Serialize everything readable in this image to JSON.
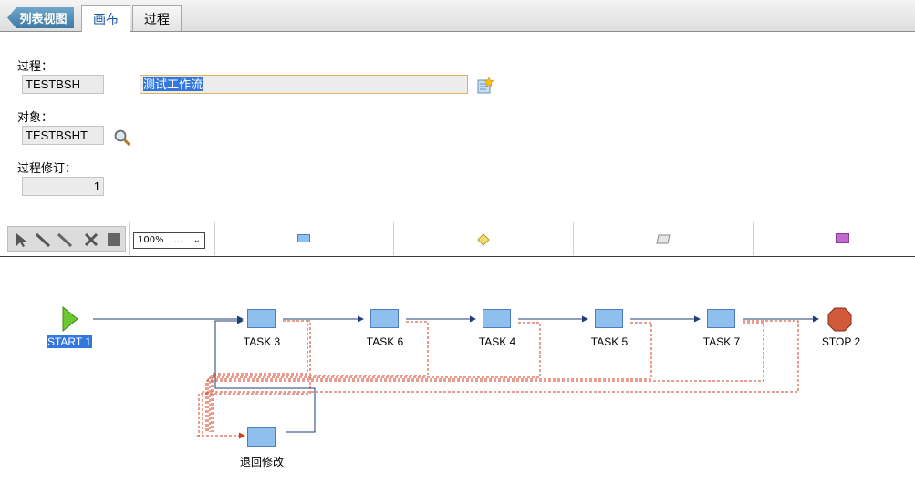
{
  "header": {
    "back_label": "列表视图",
    "tabs": [
      {
        "label": "画布",
        "active": true
      },
      {
        "label": "过程",
        "active": false
      }
    ]
  },
  "form": {
    "process_label": "过程：",
    "process_value": "TESTBSH",
    "process_desc": "测试工作流",
    "object_label": "对象：",
    "object_value": "TESTBSHT",
    "revision_label": "过程修订：",
    "revision_value": "1"
  },
  "toolbar": {
    "zoom": "100%",
    "zoom_suffix": "...",
    "palette_items": [
      "task-shape",
      "decision-shape",
      "input-shape",
      "subprocess-shape"
    ]
  },
  "diagram": {
    "nodes": [
      {
        "id": "start",
        "label": "START 1",
        "type": "start",
        "selected": true
      },
      {
        "id": "task3",
        "label": "TASK 3",
        "type": "task"
      },
      {
        "id": "task6",
        "label": "TASK 6",
        "type": "task"
      },
      {
        "id": "task4",
        "label": "TASK 4",
        "type": "task"
      },
      {
        "id": "task5",
        "label": "TASK 5",
        "type": "task"
      },
      {
        "id": "task7",
        "label": "TASK 7",
        "type": "task"
      },
      {
        "id": "stop",
        "label": "STOP 2",
        "type": "stop"
      },
      {
        "id": "return",
        "label": "退回修改",
        "type": "task"
      }
    ]
  },
  "colors": {
    "accent": "#3e7aa5",
    "positive_line": "#1f3f74",
    "negative_line": "#d63a1e",
    "task_fill": "#8fbfec",
    "stop_fill": "#d25a3c",
    "start_fill": "#6cc832"
  }
}
